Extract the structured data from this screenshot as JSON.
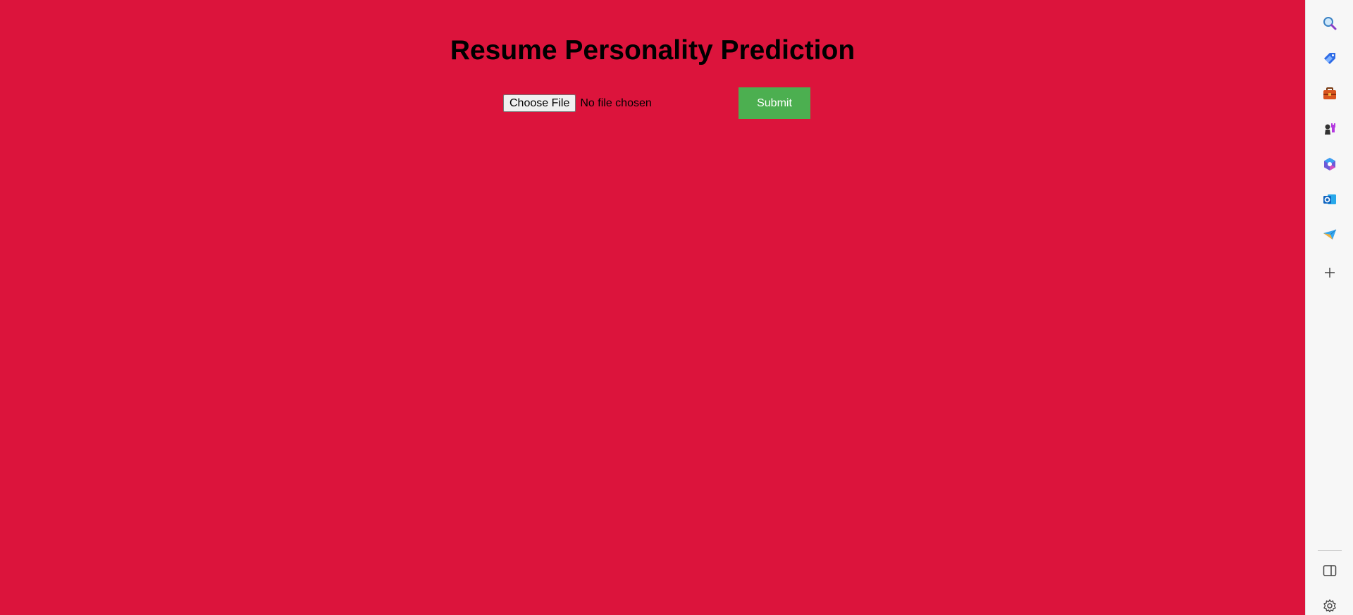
{
  "page": {
    "title": "Resume Personality Prediction",
    "background": "#DC143C"
  },
  "form": {
    "choose_file_label": "Choose File",
    "file_status": "No file chosen",
    "submit_label": "Submit",
    "submit_color": "#4CAF50"
  },
  "sidebar": {
    "items": [
      {
        "icon": "search-icon"
      },
      {
        "icon": "shopping-tag-icon"
      },
      {
        "icon": "tools-briefcase-icon"
      },
      {
        "icon": "games-chess-icon"
      },
      {
        "icon": "microsoft-365-icon"
      },
      {
        "icon": "outlook-icon"
      },
      {
        "icon": "telegram-send-icon"
      },
      {
        "icon": "add-icon"
      }
    ],
    "bottom": [
      {
        "icon": "split-panel-icon"
      },
      {
        "icon": "gear-icon"
      }
    ]
  }
}
